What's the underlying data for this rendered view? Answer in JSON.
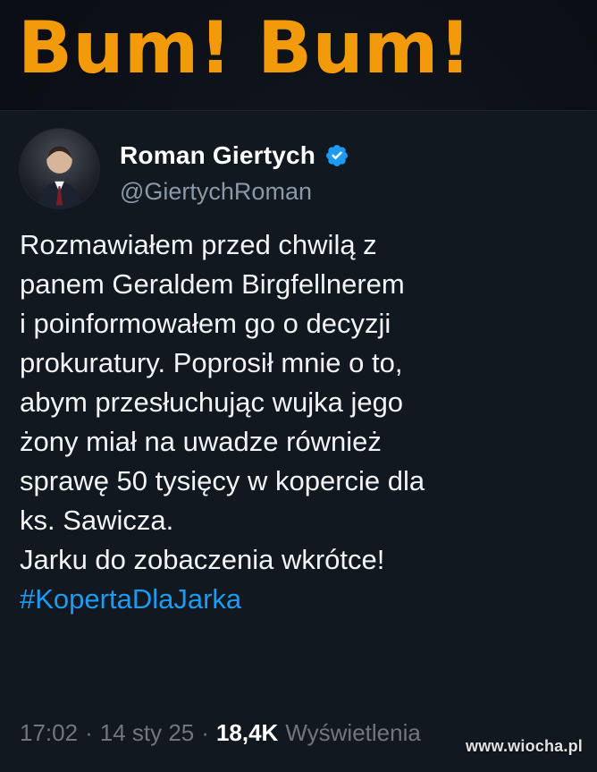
{
  "headline": "Bum! Bum!",
  "tweet": {
    "display_name": "Roman Giertych",
    "handle": "@GiertychRoman",
    "verified_icon": "verified-badge-icon",
    "body_lines": [
      "Rozmawiałem przed chwilą z",
      "panem Geraldem Birgfellnerem",
      "i poinformowałem go o decyzji",
      "prokuratury. Poprosił mnie o to,",
      "abym przesłuchując wujka jego",
      "żony miał na uwadze również",
      "sprawę 50 tysięcy w kopercie dla",
      "ks. Sawicza.",
      "Jarku do zobaczenia wkrótce!"
    ],
    "hashtag": "#KopertaDlaJarka",
    "time": "17:02",
    "date": "14 sty 25",
    "views_count": "18,4K",
    "views_label": "Wyświetlenia",
    "separator": "·"
  },
  "watermark": "www.wiocha.pl",
  "colors": {
    "background": "#0b0d12",
    "tweet_bg": "#121820",
    "headline": "#f39a0b",
    "text": "#f2f3f5",
    "muted": "#8b98a5",
    "link": "#1d9bf0",
    "verified": "#1d9bf0"
  }
}
